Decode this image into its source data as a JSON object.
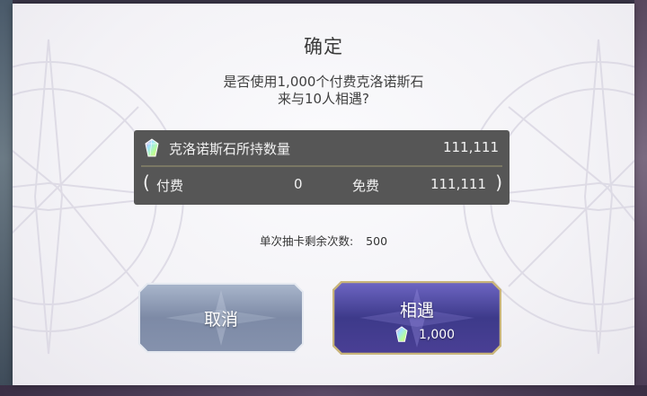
{
  "dialog": {
    "title": "确定",
    "message_line1": "是否使用1,000个付费克洛诺斯石",
    "message_line2": "来与10人相遇?"
  },
  "balance": {
    "label": "克洛诺斯石所持数量",
    "total": "111,111",
    "open_paren": "(",
    "paid_label": "付费",
    "paid_value": "0",
    "free_label": "免费",
    "free_value": "111,111",
    "close_paren": ")"
  },
  "draws": {
    "label": "单次抽卡剩余次数:",
    "value": "500"
  },
  "buttons": {
    "cancel_label": "取消",
    "confirm_label": "相遇",
    "confirm_cost": "1,000"
  },
  "icons": {
    "currency": "chronos-stone-icon"
  },
  "colors": {
    "panel": "#565656",
    "cancel_button": "#7d8aa6",
    "confirm_button": "#3d3a8a",
    "confirm_border": "#c9b57a"
  }
}
